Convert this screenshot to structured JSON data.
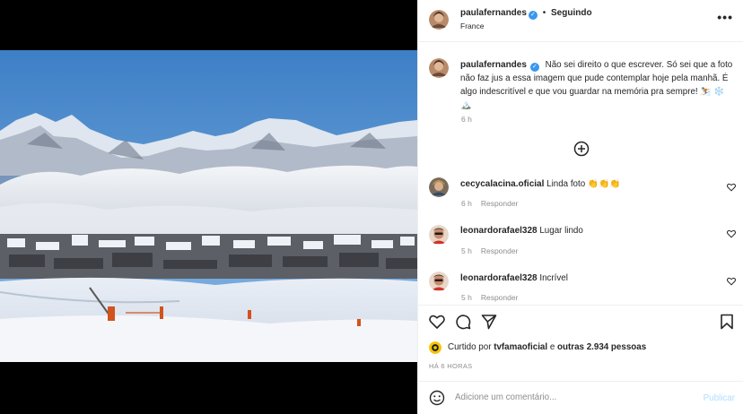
{
  "post": {
    "author": "paulafernandes",
    "follow_separator": "•",
    "follow_label": "Seguindo",
    "location": "France",
    "more_icon": "more-horizontal-icon"
  },
  "caption": {
    "author": "paulafernandes",
    "text": "Não sei direito o que escrever. Só sei que a foto não faz jus a essa imagem que pude contemplar hoje pela manhã. É algo indescritível e que vou guardar na memória pra sempre! ⛷️ ❄️ 🏔️",
    "time": "6 h"
  },
  "load_more_icon": "plus-circle-icon",
  "comments": [
    {
      "author": "cecycalacina.oficial",
      "text": "Linda foto 👏👏👏",
      "time": "6 h",
      "reply": "Responder"
    },
    {
      "author": "leonardorafael328",
      "text": "Lugar lindo",
      "time": "5 h",
      "reply": "Responder"
    },
    {
      "author": "leonardorafael328",
      "text": "Incrível",
      "time": "5 h",
      "reply": "Responder"
    }
  ],
  "likes": {
    "prefix": "Curtido por",
    "user": "tvfamaoficial",
    "middle": "e",
    "others": "outras 2.934 pessoas"
  },
  "time_ago": "HÁ 6 HORAS",
  "add_comment": {
    "placeholder": "Adicione um comentário...",
    "publish": "Publicar"
  },
  "colors": {
    "verified": "#3897f0",
    "muted": "#8e8e8e",
    "publish_disabled": "#b3dbff",
    "text": "#262626"
  }
}
